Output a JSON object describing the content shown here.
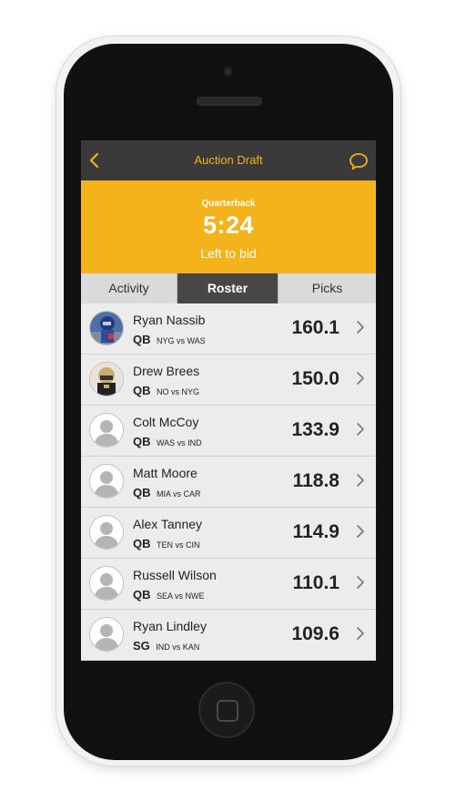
{
  "nav": {
    "back_icon": "chevron-left-icon",
    "title": "Auction Draft",
    "chat_icon": "chat-bubble-icon"
  },
  "banner": {
    "position": "Quarterback",
    "timer": "5:24",
    "subtitle": "Left to bid"
  },
  "tabs": [
    {
      "label": "Activity",
      "active": false
    },
    {
      "label": "Roster",
      "active": true
    },
    {
      "label": "Picks",
      "active": false
    }
  ],
  "players": [
    {
      "name": "Ryan Nassib",
      "position": "QB",
      "matchup": "NYG vs WAS",
      "value": "160.1",
      "avatar": "photo-nyg"
    },
    {
      "name": "Drew Brees",
      "position": "QB",
      "matchup": "NO vs NYG",
      "value": "150.0",
      "avatar": "photo-no"
    },
    {
      "name": "Colt McCoy",
      "position": "QB",
      "matchup": "WAS vs IND",
      "value": "133.9",
      "avatar": "placeholder"
    },
    {
      "name": "Matt Moore",
      "position": "QB",
      "matchup": "MIA vs CAR",
      "value": "118.8",
      "avatar": "placeholder"
    },
    {
      "name": "Alex Tanney",
      "position": "QB",
      "matchup": "TEN vs CIN",
      "value": "114.9",
      "avatar": "placeholder"
    },
    {
      "name": "Russell Wilson",
      "position": "QB",
      "matchup": "SEA vs NWE",
      "value": "110.1",
      "avatar": "placeholder"
    },
    {
      "name": "Ryan Lindley",
      "position": "SG",
      "matchup": "IND vs KAN",
      "value": "109.6",
      "avatar": "placeholder"
    }
  ],
  "colors": {
    "accent": "#f4b21b",
    "nav_bg": "#3a3a3a",
    "active_tab": "#474747"
  }
}
